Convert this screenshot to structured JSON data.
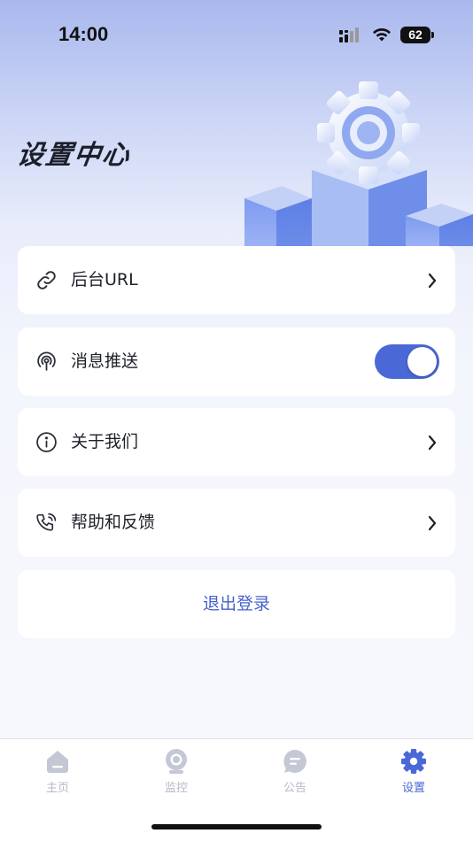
{
  "status_bar": {
    "time": "14:00",
    "battery": "62"
  },
  "header": {
    "title": "设置中心"
  },
  "settings": {
    "backend_url": {
      "label": "后台URL"
    },
    "push_notifications": {
      "label": "消息推送",
      "enabled": true
    },
    "about_us": {
      "label": "关于我们"
    },
    "help_feedback": {
      "label": "帮助和反馈"
    }
  },
  "logout": {
    "label": "退出登录"
  },
  "tabs": [
    {
      "label": "主页",
      "icon": "home-icon",
      "active": false
    },
    {
      "label": "监控",
      "icon": "camera-icon",
      "active": false
    },
    {
      "label": "公告",
      "icon": "chat-icon",
      "active": false
    },
    {
      "label": "设置",
      "icon": "gear-icon",
      "active": true
    }
  ],
  "colors": {
    "accent": "#4a68d6",
    "inactive_tab": "#c3c8d4",
    "title": "#1c1f2b"
  }
}
